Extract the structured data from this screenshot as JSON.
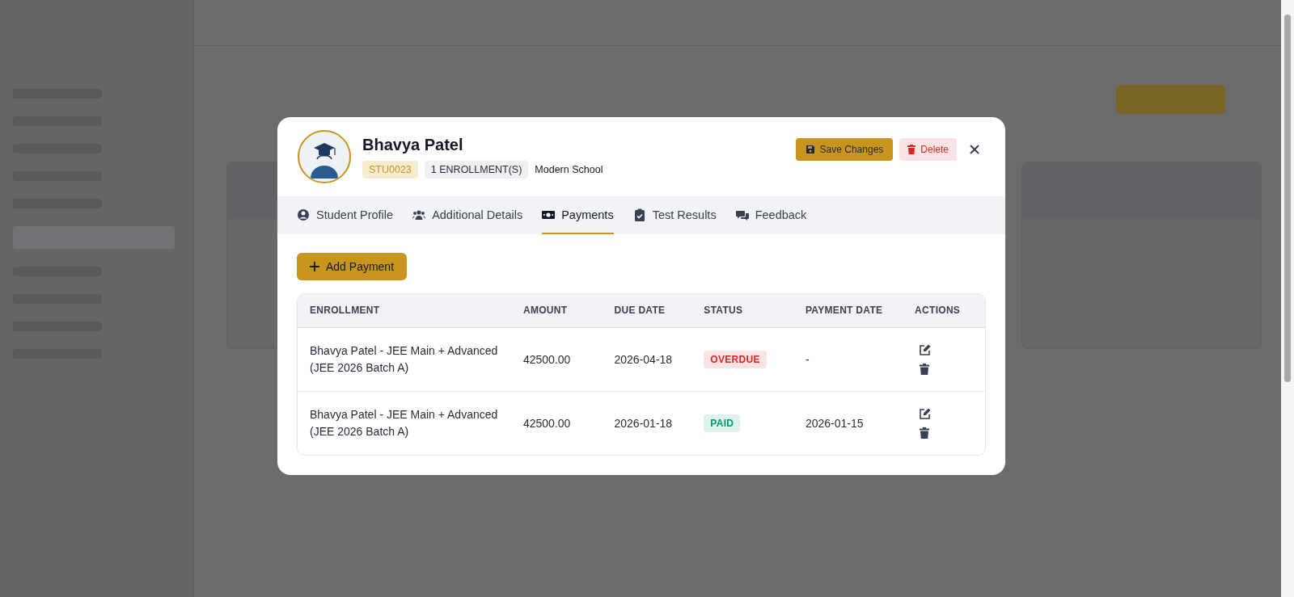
{
  "student": {
    "name": "Bhavya Patel",
    "code": "STU0023",
    "enrollments": "1 ENROLLMENT(S)",
    "school": "Modern School"
  },
  "header_actions": {
    "save": "Save Changes",
    "delete": "Delete"
  },
  "tabs": [
    {
      "label": "Student Profile",
      "selected": false
    },
    {
      "label": "Additional Details",
      "selected": false
    },
    {
      "label": "Payments",
      "selected": true
    },
    {
      "label": "Test Results",
      "selected": false
    },
    {
      "label": "Feedback",
      "selected": false
    }
  ],
  "add_payment": "Add Payment",
  "table": {
    "columns": [
      "ENROLLMENT",
      "AMOUNT",
      "DUE DATE",
      "STATUS",
      "PAYMENT DATE",
      "ACTIONS"
    ],
    "rows": [
      {
        "enrollment": "Bhavya Patel - JEE Main + Advanced (JEE 2026 Batch A)",
        "amount": "42500.00",
        "due_date": "2026-04-18",
        "status": {
          "text": "OVERDUE",
          "color": "#dc2626"
        },
        "payment_date": "-"
      },
      {
        "enrollment": "Bhavya Patel - JEE Main + Advanced (JEE 2026 Batch A)",
        "amount": "42500.00",
        "due_date": "2026-01-18",
        "status": {
          "text": "PAID",
          "color": "#059669"
        },
        "payment_date": "2026-01-15"
      }
    ]
  }
}
